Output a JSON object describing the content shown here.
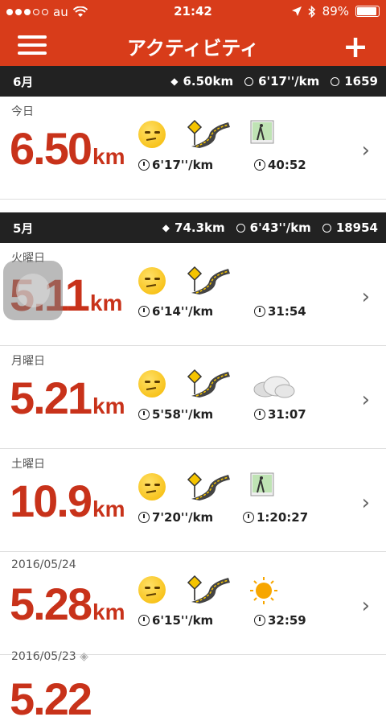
{
  "status_bar": {
    "carrier": "au",
    "time": "21:42",
    "battery": "89%"
  },
  "nav": {
    "title": "アクティビティ"
  },
  "colors": {
    "accent": "#d83c1a",
    "distance": "#c8321a",
    "header_bg": "#222222"
  },
  "sections": [
    {
      "month": "6月",
      "distance": "6.50km",
      "pace": "6'17''/km",
      "calories": "1659",
      "rows": [
        {
          "date": "今日",
          "distance": "6.50",
          "unit": "km",
          "pace": "6'17''/km",
          "time": "40:52",
          "weather": "photo-icon"
        }
      ]
    },
    {
      "month": "5月",
      "distance": "74.3km",
      "pace": "6'43''/km",
      "calories": "18954",
      "rows": [
        {
          "date": "火曜日",
          "distance": "5.11",
          "unit": "km",
          "pace": "6'14''/km",
          "time": "31:54",
          "weather": "none"
        },
        {
          "date": "月曜日",
          "distance": "5.21",
          "unit": "km",
          "pace": "5'58''/km",
          "time": "31:07",
          "weather": "cloud-icon"
        },
        {
          "date": "土曜日",
          "distance": "10.9",
          "unit": "km",
          "pace": "7'20''/km",
          "time": "1:20:27",
          "weather": "photo-icon"
        },
        {
          "date": "2016/05/24",
          "distance": "5.28",
          "unit": "km",
          "pace": "6'15''/km",
          "time": "32:59",
          "weather": "sun-icon"
        }
      ]
    }
  ],
  "partial_row": {
    "date": "2016/05/23",
    "distance": "5.22"
  }
}
